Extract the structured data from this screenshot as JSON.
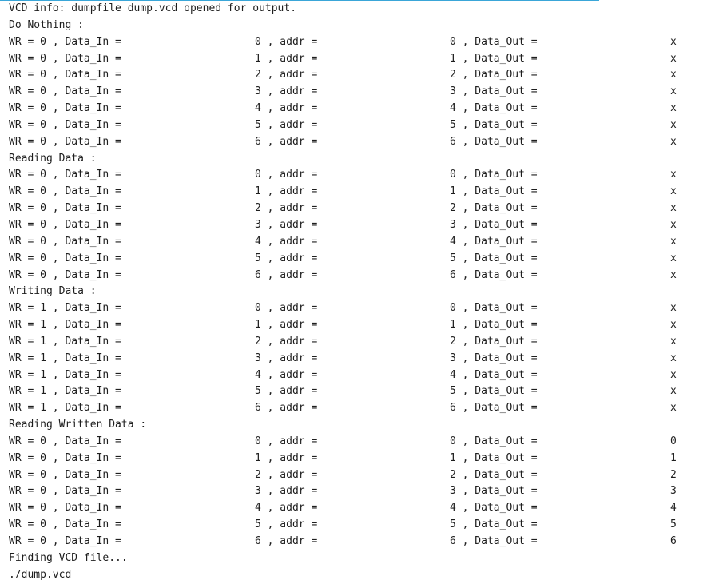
{
  "terminal": {
    "header": "VCD info: dumpfile dump.vcd opened for output.",
    "sections": [
      {
        "label": "Do Nothing :",
        "rows": [
          {
            "wr": "WR = 0 , Data_In =",
            "data_in": "0 , addr =",
            "addr": "0 , Data_Out =",
            "data_out": "x"
          },
          {
            "wr": "WR = 0 , Data_In =",
            "data_in": "1 , addr =",
            "addr": "1 , Data_Out =",
            "data_out": "x"
          },
          {
            "wr": "WR = 0 , Data_In =",
            "data_in": "2 , addr =",
            "addr": "2 , Data_Out =",
            "data_out": "x"
          },
          {
            "wr": "WR = 0 , Data_In =",
            "data_in": "3 , addr =",
            "addr": "3 , Data_Out =",
            "data_out": "x"
          },
          {
            "wr": "WR = 0 , Data_In =",
            "data_in": "4 , addr =",
            "addr": "4 , Data_Out =",
            "data_out": "x"
          },
          {
            "wr": "WR = 0 , Data_In =",
            "data_in": "5 , addr =",
            "addr": "5 , Data_Out =",
            "data_out": "x"
          },
          {
            "wr": "WR = 0 , Data_In =",
            "data_in": "6 , addr =",
            "addr": "6 , Data_Out =",
            "data_out": "x"
          }
        ]
      },
      {
        "label": "Reading Data :",
        "rows": [
          {
            "wr": "WR = 0 , Data_In =",
            "data_in": "0 , addr =",
            "addr": "0 , Data_Out =",
            "data_out": "x"
          },
          {
            "wr": "WR = 0 , Data_In =",
            "data_in": "1 , addr =",
            "addr": "1 , Data_Out =",
            "data_out": "x"
          },
          {
            "wr": "WR = 0 , Data_In =",
            "data_in": "2 , addr =",
            "addr": "2 , Data_Out =",
            "data_out": "x"
          },
          {
            "wr": "WR = 0 , Data_In =",
            "data_in": "3 , addr =",
            "addr": "3 , Data_Out =",
            "data_out": "x"
          },
          {
            "wr": "WR = 0 , Data_In =",
            "data_in": "4 , addr =",
            "addr": "4 , Data_Out =",
            "data_out": "x"
          },
          {
            "wr": "WR = 0 , Data_In =",
            "data_in": "5 , addr =",
            "addr": "5 , Data_Out =",
            "data_out": "x"
          },
          {
            "wr": "WR = 0 , Data_In =",
            "data_in": "6 , addr =",
            "addr": "6 , Data_Out =",
            "data_out": "x"
          }
        ]
      },
      {
        "label": "Writing Data :",
        "rows": [
          {
            "wr": "WR = 1 , Data_In =",
            "data_in": "0 , addr =",
            "addr": "0 , Data_Out =",
            "data_out": "x"
          },
          {
            "wr": "WR = 1 , Data_In =",
            "data_in": "1 , addr =",
            "addr": "1 , Data_Out =",
            "data_out": "x"
          },
          {
            "wr": "WR = 1 , Data_In =",
            "data_in": "2 , addr =",
            "addr": "2 , Data_Out =",
            "data_out": "x"
          },
          {
            "wr": "WR = 1 , Data_In =",
            "data_in": "3 , addr =",
            "addr": "3 , Data_Out =",
            "data_out": "x"
          },
          {
            "wr": "WR = 1 , Data_In =",
            "data_in": "4 , addr =",
            "addr": "4 , Data_Out =",
            "data_out": "x"
          },
          {
            "wr": "WR = 1 , Data_In =",
            "data_in": "5 , addr =",
            "addr": "5 , Data_Out =",
            "data_out": "x"
          },
          {
            "wr": "WR = 1 , Data_In =",
            "data_in": "6 , addr =",
            "addr": "6 , Data_Out =",
            "data_out": "x"
          }
        ]
      },
      {
        "label": "Reading Written Data :",
        "rows": [
          {
            "wr": "WR = 0 , Data_In =",
            "data_in": "0 , addr =",
            "addr": "0 , Data_Out =",
            "data_out": "0"
          },
          {
            "wr": "WR = 0 , Data_In =",
            "data_in": "1 , addr =",
            "addr": "1 , Data_Out =",
            "data_out": "1"
          },
          {
            "wr": "WR = 0 , Data_In =",
            "data_in": "2 , addr =",
            "addr": "2 , Data_Out =",
            "data_out": "2"
          },
          {
            "wr": "WR = 0 , Data_In =",
            "data_in": "3 , addr =",
            "addr": "3 , Data_Out =",
            "data_out": "3"
          },
          {
            "wr": "WR = 0 , Data_In =",
            "data_in": "4 , addr =",
            "addr": "4 , Data_Out =",
            "data_out": "4"
          },
          {
            "wr": "WR = 0 , Data_In =",
            "data_in": "5 , addr =",
            "addr": "5 , Data_Out =",
            "data_out": "5"
          },
          {
            "wr": "WR = 0 , Data_In =",
            "data_in": "6 , addr =",
            "addr": "6 , Data_Out =",
            "data_out": "6"
          }
        ]
      }
    ],
    "footer": [
      "Finding VCD file...",
      "./dump.vcd"
    ]
  },
  "colors": {
    "text": "#1e1e1e",
    "background": "#ffffff",
    "accent": "#3aa6d8"
  }
}
